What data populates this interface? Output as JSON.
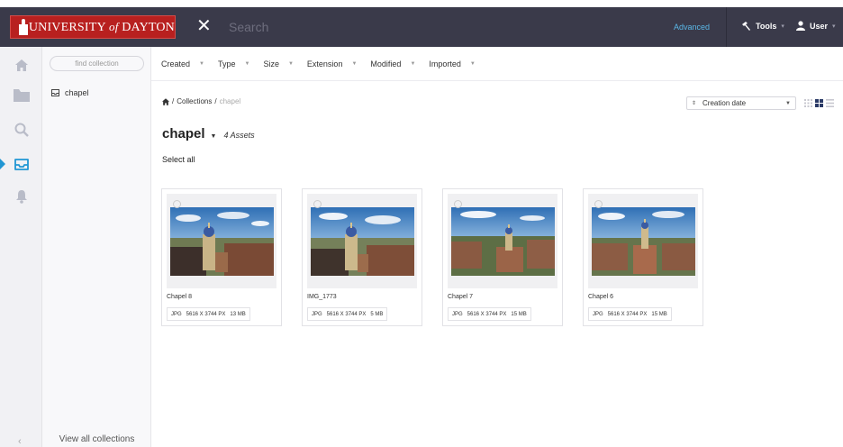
{
  "header": {
    "brand_main": "UNIVERSITY ",
    "brand_of": "of",
    "brand_end": " DAYTON",
    "close_symbol": "✕",
    "search_placeholder": "Search",
    "advanced_label": "Advanced",
    "tools_label": "Tools",
    "user_label": "User"
  },
  "sidebar": {
    "icons": [
      "home-icon",
      "folder-icon",
      "search-icon",
      "collection-tray-icon",
      "bell-icon"
    ],
    "active": "collection-tray-icon"
  },
  "collections_panel": {
    "find_placeholder": "find collection",
    "items": [
      {
        "label": "chapel"
      }
    ],
    "view_all_label": "View all collections"
  },
  "filters": [
    "Created",
    "Type",
    "Size",
    "Extension",
    "Modified",
    "Imported"
  ],
  "breadcrumb": {
    "sep": "/",
    "collections_label": "Collections",
    "current": "chapel"
  },
  "sort": {
    "selected": "Creation date"
  },
  "collection": {
    "title": "chapel",
    "asset_count": "4 Assets",
    "select_all_label": "Select all"
  },
  "assets": [
    {
      "name": "Chapel 8",
      "type": "JPG",
      "dimensions": "5616 X 3744 PX",
      "size": "13 MB"
    },
    {
      "name": "IMG_1773",
      "type": "JPG",
      "dimensions": "5616 X 3744 PX",
      "size": "5 MB"
    },
    {
      "name": "Chapel 7",
      "type": "JPG",
      "dimensions": "5616 X 3744 PX",
      "size": "15 MB"
    },
    {
      "name": "Chapel 6",
      "type": "JPG",
      "dimensions": "5616 X 3744 PX",
      "size": "15 MB"
    }
  ],
  "colors": {
    "topbar": "#3a3a4a",
    "brand_red": "#b8201f",
    "accent_blue": "#2196d3",
    "link_blue": "#5ab7e6"
  }
}
